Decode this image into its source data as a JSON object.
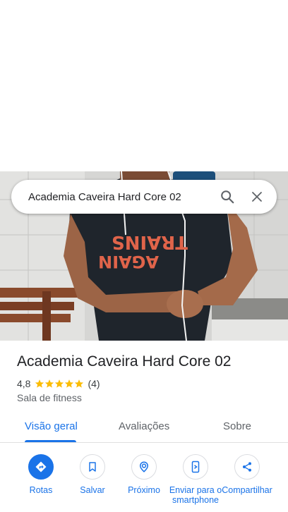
{
  "search": {
    "query": "Academia Caveira Hard Core 02",
    "search_icon": "search-icon",
    "close_icon": "close-icon"
  },
  "photo": {
    "shirt_text_line1": "TRAINS",
    "shirt_text_line2": "AGAIN"
  },
  "place": {
    "title": "Academia Caveira Hard Core 02",
    "rating": "4,8",
    "stars": 5,
    "review_count": "(4)",
    "category": "Sala de fitness"
  },
  "tabs": [
    {
      "label": "Visão geral",
      "active": true
    },
    {
      "label": "Avaliações",
      "active": false
    },
    {
      "label": "Sobre",
      "active": false
    }
  ],
  "actions": [
    {
      "label": "Rotas",
      "icon": "directions-icon"
    },
    {
      "label": "Salvar",
      "icon": "bookmark-icon"
    },
    {
      "label": "Próximo",
      "icon": "nearby-icon"
    },
    {
      "label": "Enviar para o smartphone",
      "icon": "send-to-phone-icon"
    },
    {
      "label": "Compartilhar",
      "icon": "share-icon"
    }
  ],
  "colors": {
    "accent": "#1a73e8",
    "star": "#fbbc04",
    "text": "#202124",
    "secondary_text": "#5f6368"
  }
}
